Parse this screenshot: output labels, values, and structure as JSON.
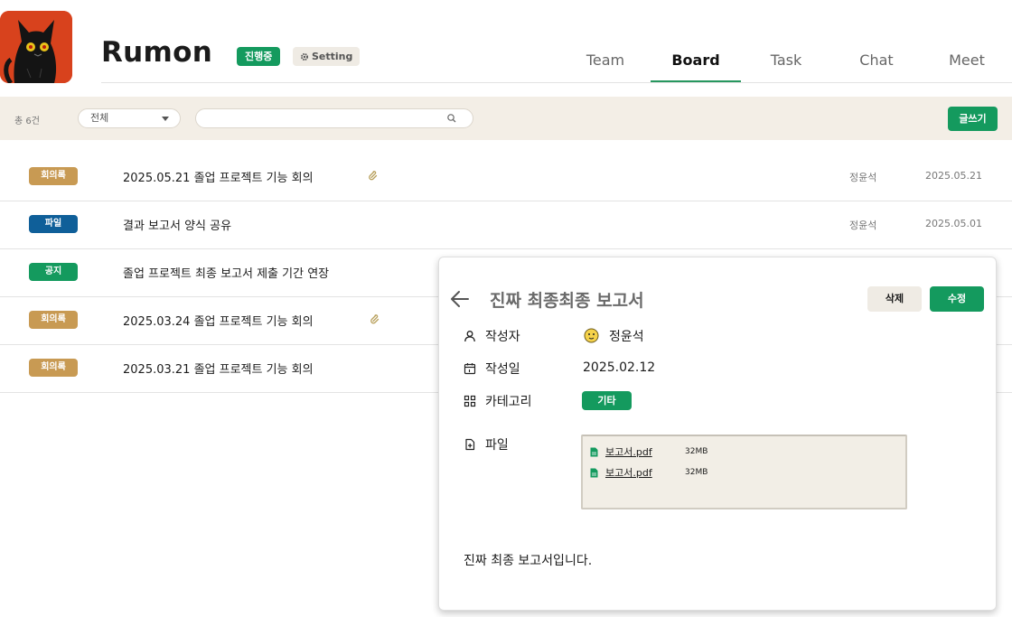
{
  "header": {
    "app_title": "Rumon",
    "status_badge": "진행중",
    "setting_label": "Setting",
    "tabs": [
      {
        "label": "Team"
      },
      {
        "label": "Board"
      },
      {
        "label": "Task"
      },
      {
        "label": "Chat"
      },
      {
        "label": "Meet"
      }
    ],
    "active_tab": "Board"
  },
  "toolbar": {
    "total_count": "총 6건",
    "filter_value": "전체",
    "search_placeholder": "",
    "write_label": "글쓰기"
  },
  "posts": [
    {
      "tag": "회의록",
      "tag_color": "#c89a53",
      "title": "2025.05.21 졸업 프로젝트 기능 회의",
      "has_attachment": true,
      "author": "정윤석",
      "date": "2025.05.21"
    },
    {
      "tag": "파일",
      "tag_color": "#0f5f99",
      "title": "결과 보고서 양식 공유",
      "has_attachment": false,
      "author": "정윤석",
      "date": "2025.05.01"
    },
    {
      "tag": "공지",
      "tag_color": "#149a5e",
      "title": "졸업 프로젝트 최종 보고서 제출 기간 연장",
      "has_attachment": false,
      "author": "",
      "date": ""
    },
    {
      "tag": "회의록",
      "tag_color": "#c89a53",
      "title": "2025.03.24 졸업 프로젝트 기능 회의",
      "has_attachment": true,
      "author": "",
      "date": ""
    },
    {
      "tag": "회의록",
      "tag_color": "#c89a53",
      "title": "2025.03.21 졸업 프로젝트 기능 회의",
      "has_attachment": false,
      "author": "",
      "date": ""
    }
  ],
  "detail": {
    "title": "진짜 최종최종 보고서",
    "delete_label": "삭제",
    "edit_label": "수정",
    "author_label": "작성자",
    "author": "정윤석",
    "date_label": "작성일",
    "date": "2025.02.12",
    "category_label": "카테고리",
    "category": "기타",
    "files_label": "파일",
    "files": [
      {
        "name": "보고서.pdf",
        "size": "32MB"
      },
      {
        "name": "보고서.pdf",
        "size": "32MB"
      }
    ],
    "body": "진짜 최종 보고서입니다."
  },
  "colors": {
    "accent_green": "#149a5e",
    "toolbar_bg": "#f3eee6",
    "tag_minutes": "#c89a53",
    "tag_file": "#0f5f99",
    "tag_notice": "#149a5e"
  },
  "icons": [
    "cat-logo",
    "gear-icon",
    "search-icon",
    "dropdown-caret-icon",
    "paperclip-icon",
    "back-arrow-icon",
    "user-icon",
    "calendar-icon",
    "grid-icon",
    "file-add-icon",
    "file-doc-icon"
  ]
}
